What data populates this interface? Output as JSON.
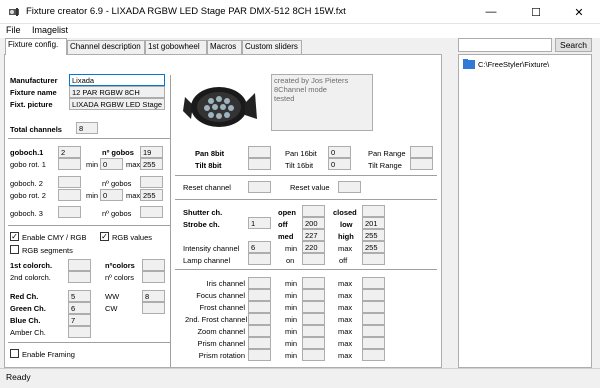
{
  "window": {
    "title": "Fixture creator 6.9 - LIXADA RGBW LED Stage PAR DMX-512 8CH 15W.fxt",
    "minimize": "—",
    "maximize": "☐",
    "close": "✕"
  },
  "menu": [
    "File",
    "Imagelist"
  ],
  "tabs": [
    "Fixture config.",
    "Channel description",
    "1st gobowheel",
    "Macros",
    "Custom sliders"
  ],
  "search": {
    "value": "",
    "button": "Search"
  },
  "tree": {
    "path": "C:\\FreeStyler\\Fixture\\"
  },
  "status": "Ready",
  "info": {
    "manufacturer_label": "Manufacturer",
    "manufacturer": "Lixada",
    "fixture_name_label": "Fixture name",
    "fixture_name": "12 PAR RGBW 8CH",
    "picture_label": "Fixt. picture",
    "picture": "LIXADA RGBW LED Stage",
    "notes": [
      "created by Jos Pieters",
      "8Channel mode",
      "tested"
    ]
  },
  "total": {
    "label": "Total channels",
    "value": "8"
  },
  "gobos": {
    "g1_label": "goboch.1",
    "g1": "2",
    "g1_count_label": "nº gobos",
    "g1_count": "19",
    "rot1_label": "gobo rot. 1",
    "min_label": "min",
    "max_label": "max",
    "rot1_min": "0",
    "rot1_max": "255",
    "g2_label": "goboch. 2",
    "g2_count_label": "nº gobos",
    "rot2_label": "gobo rot. 2",
    "rot2_min": "0",
    "rot2_max": "255",
    "g3_label": "goboch. 3",
    "g3_count_label": "nº gobos"
  },
  "cmy": {
    "enable_label": "Enable CMY / RGB",
    "enable_checked": "✓",
    "rgb_values_label": "RGB values",
    "rgb_values_checked": "✓",
    "segments_label": "RGB segments"
  },
  "colors": {
    "c1_label": "1st colorch.",
    "c2_label": "2nd colorch.",
    "ncolors1_label": "nºcolors",
    "ncolors2_label": "nº colors",
    "red_label": "Red Ch.",
    "red": "5",
    "green_label": "Green Ch.",
    "green": "6",
    "blue_label": "Blue Ch.",
    "blue": "7",
    "amber_label": "Amber Ch.",
    "ww_label": "WW",
    "ww": "8",
    "cw_label": "CW"
  },
  "framing": {
    "label": "Enable Framing"
  },
  "pantilt": {
    "pan8_label": "Pan 8bit",
    "tilt8_label": "Tilt 8bit",
    "pan16_label": "Pan 16bit",
    "pan16": "0",
    "tilt16_label": "Tilt 16bit",
    "tilt16": "0",
    "pan_range_label": "Pan Range",
    "tilt_range_label": "Tilt Range"
  },
  "reset": {
    "channel_label": "Reset channel",
    "value_label": "Reset value"
  },
  "shutter": {
    "shutter_label": "Shutter ch.",
    "strobe_label": "Strobe ch.",
    "strobe": "1",
    "open_label": "open",
    "closed_label": "closed",
    "off_label": "off",
    "off": "200",
    "low_label": "low",
    "low": "201",
    "med_label": "med",
    "med": "227",
    "high_label": "high",
    "high": "255",
    "intensity_label": "Intensity channel",
    "intensity": "6",
    "int_min_label": "min",
    "int_min": "220",
    "int_max_label": "max",
    "int_max": "255",
    "lamp_label": "Lamp channel",
    "on_label": "on",
    "lamp_off_label": "off"
  },
  "channels": [
    {
      "label": "Iris channel",
      "min": "min",
      "max": "max"
    },
    {
      "label": "Focus channel",
      "min": "min",
      "max": "max"
    },
    {
      "label": "Frost channel",
      "min": "min",
      "max": "max"
    },
    {
      "label": "2nd. Frost channel",
      "min": "min",
      "max": "max"
    },
    {
      "label": "Zoom channel",
      "min": "min",
      "max": "max"
    },
    {
      "label": "Prism channel",
      "min": "min",
      "max": "max"
    },
    {
      "label": "Prism rotation",
      "min": "min",
      "max": "max"
    }
  ]
}
